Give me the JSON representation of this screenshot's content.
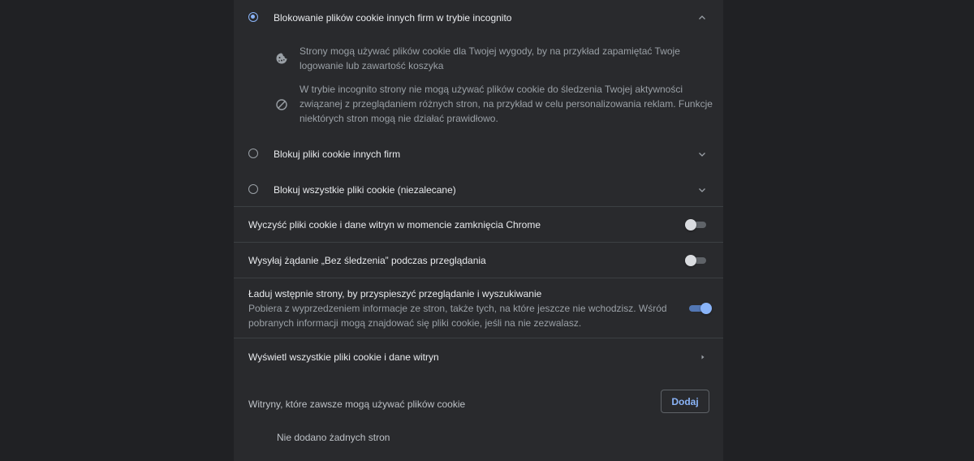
{
  "cookie_options": {
    "incognito": {
      "label": "Blokowanie plików cookie innych firm w trybie incognito",
      "selected": true,
      "expanded": true,
      "details": [
        {
          "icon": "cookie-icon",
          "text_line1": "Strony mogą używać plików cookie dla Twojej wygody, by na przykład zapamiętać Twoje",
          "text_line2": "logowanie lub zawartość koszyka"
        },
        {
          "icon": "block-icon",
          "text_line1": "W trybie incognito strony nie mogą używać plików cookie do śledzenia Twojej aktywności",
          "text_line2": "związanej z przeglądaniem różnych stron, na przykład w celu personalizowania reklam. Funkcje",
          "text_line3": "niektórych stron mogą nie działać prawidłowo."
        }
      ]
    },
    "third_party": {
      "label": "Blokuj pliki cookie innych firm",
      "selected": false
    },
    "all": {
      "label": "Blokuj wszystkie pliki cookie (niezalecane)",
      "selected": false
    }
  },
  "toggles": {
    "clear_on_exit": {
      "label": "Wyczyść pliki cookie i dane witryn w momencie zamknięcia Chrome",
      "on": false
    },
    "do_not_track": {
      "label": "Wysyłaj żądanie „Bez śledzenia” podczas przeglądania",
      "on": false
    },
    "preload": {
      "label": "Ładuj wstępnie strony, by przyspieszyć przeglądanie i wyszukiwanie",
      "sub_line1": "Pobiera z wyprzedzeniem informacje ze stron, także tych, na które jeszcze nie wchodzisz. Wśród",
      "sub_line2": "pobranych informacji mogą znajdować się pliki cookie, jeśli na nie zezwalasz.",
      "on": true
    }
  },
  "see_all": {
    "label": "Wyświetl wszystkie pliki cookie i dane witryn"
  },
  "allowed_sites": {
    "heading": "Witryny, które zawsze mogą używać plików cookie",
    "add_label": "Dodaj",
    "empty_text": "Nie dodano żadnych stron"
  },
  "colors": {
    "accent": "#8ab4f8",
    "background": "#202124",
    "card": "#292a2d"
  }
}
